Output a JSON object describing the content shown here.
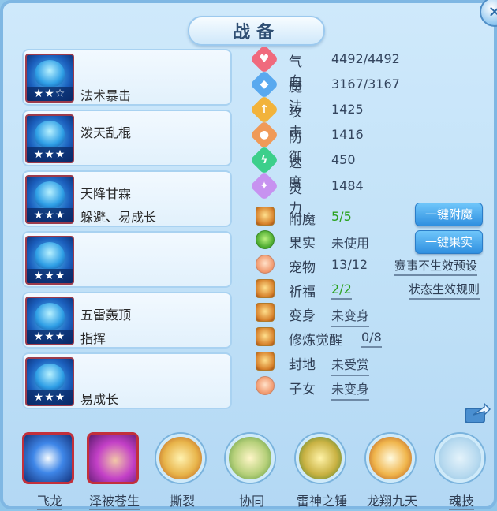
{
  "window": {
    "title": "战备"
  },
  "skills": [
    {
      "name": "法术暴击",
      "stars": "★★☆"
    },
    {
      "name": "泼天乱棍",
      "stars": "★★★"
    },
    {
      "name": "天降甘霖",
      "sub": "躲避、易成长",
      "stars": "★★★"
    },
    {
      "name": "",
      "stars": "★★★"
    },
    {
      "name": "五雷轰顶",
      "sub": "指挥",
      "stars": "★★★"
    },
    {
      "name": "易成长",
      "stars": "★★★"
    }
  ],
  "stats": [
    {
      "label": "气血",
      "value": "4492/4492",
      "color": "#f06a7d",
      "icon": "heart-icon"
    },
    {
      "label": "魔法",
      "value": "3167/3167",
      "color": "#59a9ef",
      "icon": "mana-icon"
    },
    {
      "label": "攻击",
      "value": "1425",
      "color": "#f2b33b",
      "icon": "sword-icon"
    },
    {
      "label": "防御",
      "value": "1416",
      "color": "#f09a58",
      "icon": "shield-icon"
    },
    {
      "label": "速度",
      "value": "450",
      "color": "#3ccf8b",
      "icon": "speed-icon"
    },
    {
      "label": "灵力",
      "value": "1484",
      "color": "#c792f0",
      "icon": "spirit-icon"
    }
  ],
  "attrs": {
    "fumo": {
      "label": "附魔",
      "value": "5/5"
    },
    "guoshi": {
      "label": "果实",
      "value": "未使用"
    },
    "chongwu": {
      "label": "宠物",
      "value": "13/12"
    },
    "qifu": {
      "label": "祈福",
      "value": "2/2"
    },
    "bianshen": {
      "label": "变身",
      "value": "未变身"
    },
    "xiulian": {
      "label": "修炼觉醒",
      "value": "0/8"
    },
    "fengdi": {
      "label": "封地",
      "value": "未受赏"
    },
    "zinv": {
      "label": "子女",
      "value": "未变身"
    }
  },
  "buttons": {
    "fumo": "一键附魔",
    "guoshi": "一键果实"
  },
  "links": {
    "preset": "赛事不生效预设",
    "rule": "状态生效规则"
  },
  "bottom_skills": [
    {
      "label": "飞龙"
    },
    {
      "label": "泽被苍生"
    },
    {
      "label": "撕裂"
    },
    {
      "label": "协同"
    },
    {
      "label": "雷神之锤"
    },
    {
      "label": "龙翔九天"
    },
    {
      "label": "魂技"
    }
  ]
}
